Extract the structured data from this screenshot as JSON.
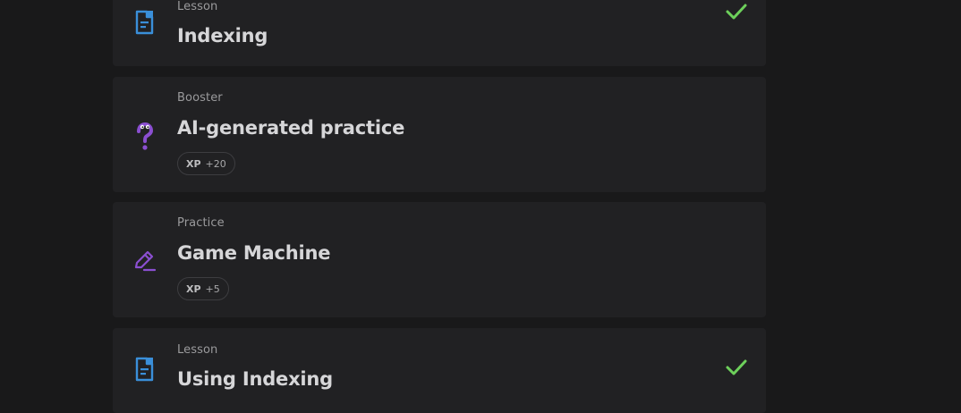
{
  "items": [
    {
      "kind": "Lesson",
      "title": "Indexing",
      "xp_label": "",
      "xp_value": "",
      "completed": true
    },
    {
      "kind": "Booster",
      "title": "AI-generated practice",
      "xp_label": "XP",
      "xp_value": "+20",
      "completed": false
    },
    {
      "kind": "Practice",
      "title": "Game Machine",
      "xp_label": "XP",
      "xp_value": "+5",
      "completed": false
    },
    {
      "kind": "Lesson",
      "title": "Using Indexing",
      "xp_label": "",
      "xp_value": "",
      "completed": true
    }
  ],
  "icons": {
    "lesson": "document-icon",
    "booster": "question-mark-icon",
    "practice": "pencil-edit-icon",
    "done": "checkmark-icon"
  },
  "colors": {
    "background": "#19191a",
    "card": "#212123",
    "lesson_icon": "#3a8fd9",
    "booster_icon": "#8b4fd1",
    "practice_icon": "#8b4fd1",
    "check": "#6dd05b"
  }
}
